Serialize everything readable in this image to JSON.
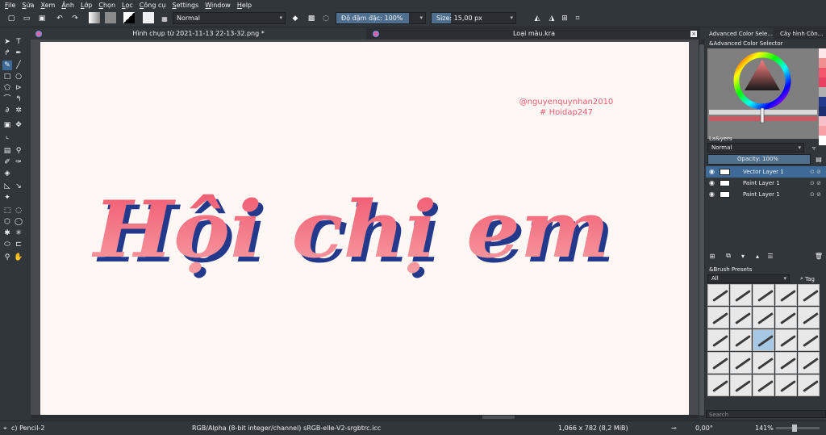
{
  "menu": [
    "File",
    "Sửa",
    "Xem",
    "Ảnh",
    "Lớp",
    "Chọn",
    "Lọc",
    "Công cụ",
    "Settings",
    "Window",
    "Help"
  ],
  "toolbar": {
    "blend_mode": "Normal",
    "opacity_label": "Độ đậm đặc: 100%",
    "opacity_level": 1.0,
    "size_label": "Size: 15,00 px",
    "size_level": 0.15
  },
  "tabs": [
    {
      "title": "Hình chụp từ 2021-11-13 22-13-32.png *"
    },
    {
      "title": "Loại màu.kra"
    }
  ],
  "canvas": {
    "watermark_line1": "@nguyenquynhan2010",
    "watermark_line2": "# Hoidap247",
    "art_text": "Hội chị em",
    "art_color": "#f2566d",
    "art_shadow_color": "#23398c"
  },
  "dock": {
    "tab1": "Advanced Color Sele...",
    "tab2": "Cây hình Côn...",
    "color_title": "&Advanced Color Selector",
    "layers_title": "La&yers",
    "layer_blend": "Normal",
    "layer_opacity": "Opacity: 100%",
    "layers": [
      {
        "name": "Vector Layer 1",
        "selected": true
      },
      {
        "name": "Paint Layer 1",
        "selected": false
      },
      {
        "name": "Paint Layer 1",
        "selected": false
      }
    ],
    "brush_title": "&Brush Presets",
    "brush_filter": "All",
    "brush_tag": "Tag",
    "search_placeholder": "Search"
  },
  "status": {
    "tool": "c) Pencil-2",
    "colorspace": "RGB/Alpha (8-bit integer/channel)  sRGB-elle-V2-srgbtrc.icc",
    "size": "1,066 x 782 (8,2 MiB)",
    "rotation": "0,00°",
    "zoom": "141%"
  },
  "colors": {
    "bg": "#31363b",
    "accent": "#3e6a97",
    "canvas": "#fff7f3"
  }
}
